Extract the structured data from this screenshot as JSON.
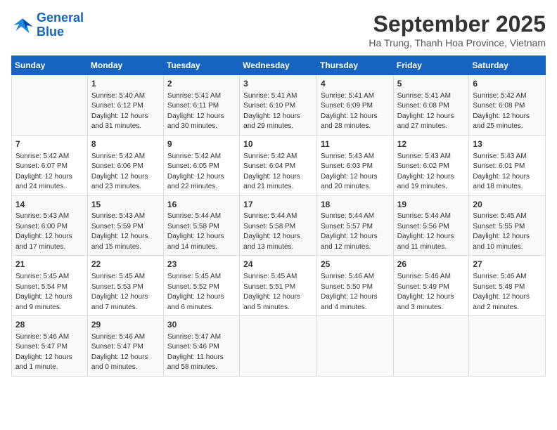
{
  "header": {
    "logo_line1": "General",
    "logo_line2": "Blue",
    "month": "September 2025",
    "location": "Ha Trung, Thanh Hoa Province, Vietnam"
  },
  "columns": [
    "Sunday",
    "Monday",
    "Tuesday",
    "Wednesday",
    "Thursday",
    "Friday",
    "Saturday"
  ],
  "weeks": [
    [
      {
        "day": "",
        "info": ""
      },
      {
        "day": "1",
        "info": "Sunrise: 5:40 AM\nSunset: 6:12 PM\nDaylight: 12 hours\nand 31 minutes."
      },
      {
        "day": "2",
        "info": "Sunrise: 5:41 AM\nSunset: 6:11 PM\nDaylight: 12 hours\nand 30 minutes."
      },
      {
        "day": "3",
        "info": "Sunrise: 5:41 AM\nSunset: 6:10 PM\nDaylight: 12 hours\nand 29 minutes."
      },
      {
        "day": "4",
        "info": "Sunrise: 5:41 AM\nSunset: 6:09 PM\nDaylight: 12 hours\nand 28 minutes."
      },
      {
        "day": "5",
        "info": "Sunrise: 5:41 AM\nSunset: 6:08 PM\nDaylight: 12 hours\nand 27 minutes."
      },
      {
        "day": "6",
        "info": "Sunrise: 5:42 AM\nSunset: 6:08 PM\nDaylight: 12 hours\nand 25 minutes."
      }
    ],
    [
      {
        "day": "7",
        "info": "Sunrise: 5:42 AM\nSunset: 6:07 PM\nDaylight: 12 hours\nand 24 minutes."
      },
      {
        "day": "8",
        "info": "Sunrise: 5:42 AM\nSunset: 6:06 PM\nDaylight: 12 hours\nand 23 minutes."
      },
      {
        "day": "9",
        "info": "Sunrise: 5:42 AM\nSunset: 6:05 PM\nDaylight: 12 hours\nand 22 minutes."
      },
      {
        "day": "10",
        "info": "Sunrise: 5:42 AM\nSunset: 6:04 PM\nDaylight: 12 hours\nand 21 minutes."
      },
      {
        "day": "11",
        "info": "Sunrise: 5:43 AM\nSunset: 6:03 PM\nDaylight: 12 hours\nand 20 minutes."
      },
      {
        "day": "12",
        "info": "Sunrise: 5:43 AM\nSunset: 6:02 PM\nDaylight: 12 hours\nand 19 minutes."
      },
      {
        "day": "13",
        "info": "Sunrise: 5:43 AM\nSunset: 6:01 PM\nDaylight: 12 hours\nand 18 minutes."
      }
    ],
    [
      {
        "day": "14",
        "info": "Sunrise: 5:43 AM\nSunset: 6:00 PM\nDaylight: 12 hours\nand 17 minutes."
      },
      {
        "day": "15",
        "info": "Sunrise: 5:43 AM\nSunset: 5:59 PM\nDaylight: 12 hours\nand 15 minutes."
      },
      {
        "day": "16",
        "info": "Sunrise: 5:44 AM\nSunset: 5:58 PM\nDaylight: 12 hours\nand 14 minutes."
      },
      {
        "day": "17",
        "info": "Sunrise: 5:44 AM\nSunset: 5:58 PM\nDaylight: 12 hours\nand 13 minutes."
      },
      {
        "day": "18",
        "info": "Sunrise: 5:44 AM\nSunset: 5:57 PM\nDaylight: 12 hours\nand 12 minutes."
      },
      {
        "day": "19",
        "info": "Sunrise: 5:44 AM\nSunset: 5:56 PM\nDaylight: 12 hours\nand 11 minutes."
      },
      {
        "day": "20",
        "info": "Sunrise: 5:45 AM\nSunset: 5:55 PM\nDaylight: 12 hours\nand 10 minutes."
      }
    ],
    [
      {
        "day": "21",
        "info": "Sunrise: 5:45 AM\nSunset: 5:54 PM\nDaylight: 12 hours\nand 9 minutes."
      },
      {
        "day": "22",
        "info": "Sunrise: 5:45 AM\nSunset: 5:53 PM\nDaylight: 12 hours\nand 7 minutes."
      },
      {
        "day": "23",
        "info": "Sunrise: 5:45 AM\nSunset: 5:52 PM\nDaylight: 12 hours\nand 6 minutes."
      },
      {
        "day": "24",
        "info": "Sunrise: 5:45 AM\nSunset: 5:51 PM\nDaylight: 12 hours\nand 5 minutes."
      },
      {
        "day": "25",
        "info": "Sunrise: 5:46 AM\nSunset: 5:50 PM\nDaylight: 12 hours\nand 4 minutes."
      },
      {
        "day": "26",
        "info": "Sunrise: 5:46 AM\nSunset: 5:49 PM\nDaylight: 12 hours\nand 3 minutes."
      },
      {
        "day": "27",
        "info": "Sunrise: 5:46 AM\nSunset: 5:48 PM\nDaylight: 12 hours\nand 2 minutes."
      }
    ],
    [
      {
        "day": "28",
        "info": "Sunrise: 5:46 AM\nSunset: 5:47 PM\nDaylight: 12 hours\nand 1 minute."
      },
      {
        "day": "29",
        "info": "Sunrise: 5:46 AM\nSunset: 5:47 PM\nDaylight: 12 hours\nand 0 minutes."
      },
      {
        "day": "30",
        "info": "Sunrise: 5:47 AM\nSunset: 5:46 PM\nDaylight: 11 hours\nand 58 minutes."
      },
      {
        "day": "",
        "info": ""
      },
      {
        "day": "",
        "info": ""
      },
      {
        "day": "",
        "info": ""
      },
      {
        "day": "",
        "info": ""
      }
    ]
  ]
}
